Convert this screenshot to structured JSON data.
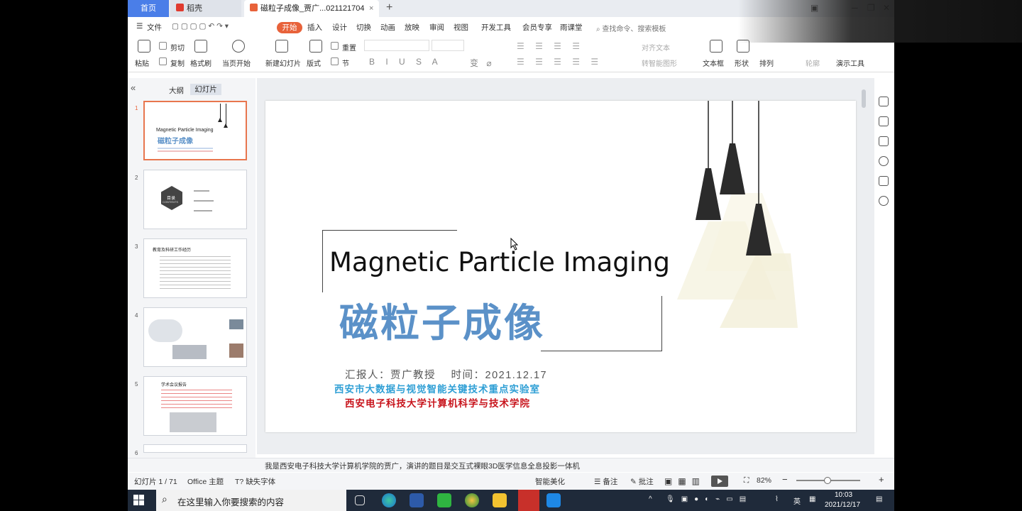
{
  "tabs": {
    "home": "首页",
    "daoke": "稻壳",
    "doc": "磁粒子成像_贾广...021121704"
  },
  "menu": {
    "file": "文件",
    "items": [
      "开始",
      "插入",
      "设计",
      "切换",
      "动画",
      "放映",
      "审阅",
      "视图",
      "开发工具",
      "会员专享",
      "雨课堂"
    ],
    "search_placeholder": "查找命令、搜索模板"
  },
  "ribbon": {
    "paste": "粘贴",
    "cut": "剪切",
    "copy": "复制",
    "format_painter": "格式刷",
    "play_from_current": "当页开始",
    "new_slide": "新建幻灯片",
    "layout": "版式",
    "section": "节",
    "reset": "重置",
    "align_text": "对齐文本",
    "smartart": "转智能图形",
    "text_box": "文本框",
    "shape": "形状",
    "arrange": "排列",
    "outline": "轮廓",
    "present_tools": "演示工具"
  },
  "panel": {
    "outline_tab": "大纲",
    "slides_tab": "幻灯片",
    "slide_numbers": [
      "1",
      "2",
      "3",
      "4",
      "5",
      "6"
    ]
  },
  "thumbs": {
    "t1_en": "Magnetic Particle Imaging",
    "t1_cn": "磁粒子成像",
    "t2_label": "目录",
    "t2_sub": "CONTENTS",
    "t3_title": "教育及科研工作经历",
    "t5_title": "学术会议报告"
  },
  "slide": {
    "title_en": "Magnetic Particle Imaging",
    "title_cn": "磁粒子成像",
    "reporter": "汇报人：贾广教授　 时间：2021.12.17",
    "lab": "西安市大数据与视觉智能关键技术重点实验室",
    "college": "西安电子科技大学计算机科学与技术学院"
  },
  "notes": {
    "text": "我是西安电子科技大学计算机学院的贾广，演讲的题目是交互式裸眼3D医学信息全息投影一体机"
  },
  "status": {
    "slide_counter": "幻灯片 1 / 71",
    "theme": "Office 主题",
    "missing_font": "缺失字体",
    "smart_beautify": "智能美化",
    "notes_btn": "备注",
    "comment_btn": "批注",
    "zoom": "82%",
    "zoom_fraction": 0.82
  },
  "taskbar": {
    "search_placeholder": "在这里输入你要搜索的内容",
    "lang": "英",
    "time": "10:03",
    "date": "2021/12/17"
  },
  "colors": {
    "accent_tab": "#4a7ee8",
    "start_btn": "#e8623a",
    "title_cn": "#5b91c8",
    "lab": "#2f9fd5",
    "college": "#c8151d"
  }
}
